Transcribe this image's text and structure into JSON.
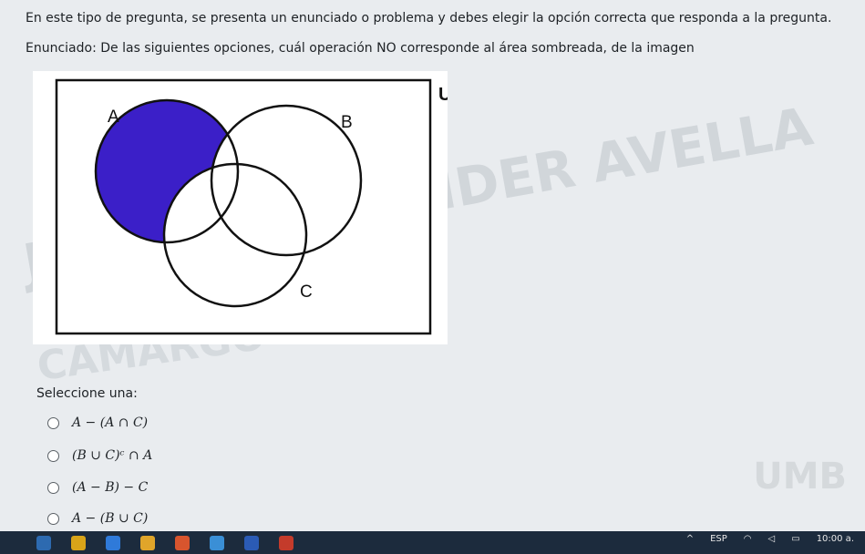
{
  "instructions": "En este tipo de pregunta, se presenta un enunciado o problema y debes elegir la opción correcta que responda a la pregunta.",
  "statement": "Enunciado: De las siguientes opciones, cuál operación NO corresponde al área sombreada, de la imagen",
  "diagram": {
    "universe_label": "U",
    "set_a_label": "A",
    "set_b_label": "B",
    "set_c_label": "C",
    "shaded_region": "A − (B ∪ C)",
    "shade_color": "#3b1fc8"
  },
  "watermarks": [
    "JIMMY ALEXANDER AVELLA",
    "CAMARGO",
    "UMB"
  ],
  "prompt": "Seleccione una:",
  "options": [
    {
      "label": "A − (A ∩ C)"
    },
    {
      "label": "(B ∪ C)ᶜ ∩ A"
    },
    {
      "label": "(A − B) − C"
    },
    {
      "label": "A − (B ∪ C)"
    }
  ],
  "taskbar": {
    "language": "ESP",
    "time": "10:00 a."
  }
}
